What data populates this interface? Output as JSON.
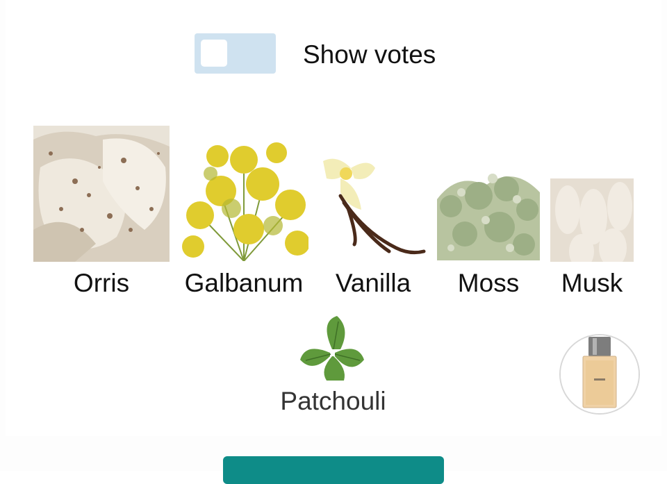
{
  "toggle": {
    "label": "Show votes",
    "state": "off",
    "track_color": "#cfe2f0"
  },
  "notes": [
    {
      "name": "Orris",
      "icon": "orris-root-image"
    },
    {
      "name": "Galbanum",
      "icon": "galbanum-flowers-image"
    },
    {
      "name": "Vanilla",
      "icon": "vanilla-orchid-image"
    },
    {
      "name": "Moss",
      "icon": "oakmoss-image"
    },
    {
      "name": "Musk",
      "icon": "white-musk-image"
    },
    {
      "name": "Patchouli",
      "icon": "patchouli-leaves-image"
    }
  ],
  "perfume": {
    "icon": "perfume-bottle-image"
  },
  "colors": {
    "accent": "#0e8c88",
    "text": "#111111"
  }
}
